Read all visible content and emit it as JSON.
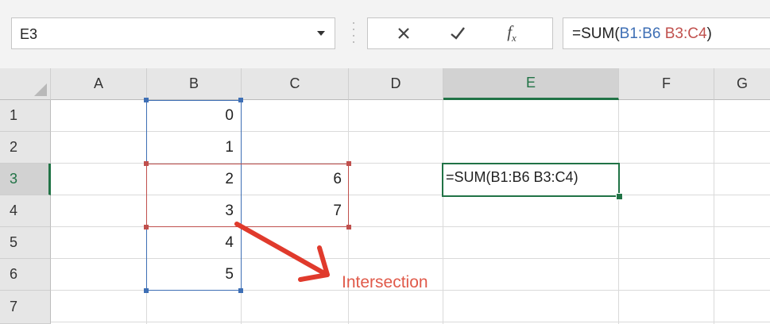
{
  "formula_bar": {
    "name_box_value": "E3",
    "formula_prefix": "=SUM(",
    "formula_ref1": "B1:B6",
    "formula_space": " ",
    "formula_ref2": "B3:C4",
    "formula_suffix": ")",
    "fx_label": "fx"
  },
  "columns": [
    {
      "label": ""
    },
    {
      "label": "A"
    },
    {
      "label": "B"
    },
    {
      "label": "C"
    },
    {
      "label": "D"
    },
    {
      "label": "E"
    },
    {
      "label": "F"
    },
    {
      "label": "G"
    }
  ],
  "rows": [
    "1",
    "2",
    "3",
    "4",
    "5",
    "6",
    "7"
  ],
  "selected": {
    "column": "E",
    "row": "3"
  },
  "cells": {
    "B1": "0",
    "B2": "1",
    "B3": "2",
    "B4": "3",
    "B5": "4",
    "B6": "5",
    "C3": "6",
    "C4": "7",
    "E3": "=SUM(B1:B6 B3:C4)"
  },
  "annotation": {
    "label": "Intersection",
    "color": "#e05a4a"
  },
  "colors": {
    "accent_green": "#217346",
    "range_blue": "#3e6fb5",
    "range_red": "#c0504d"
  },
  "icons": [
    "dropdown-arrow-icon",
    "cancel-x-icon",
    "enter-check-icon",
    "insert-function-icon"
  ]
}
